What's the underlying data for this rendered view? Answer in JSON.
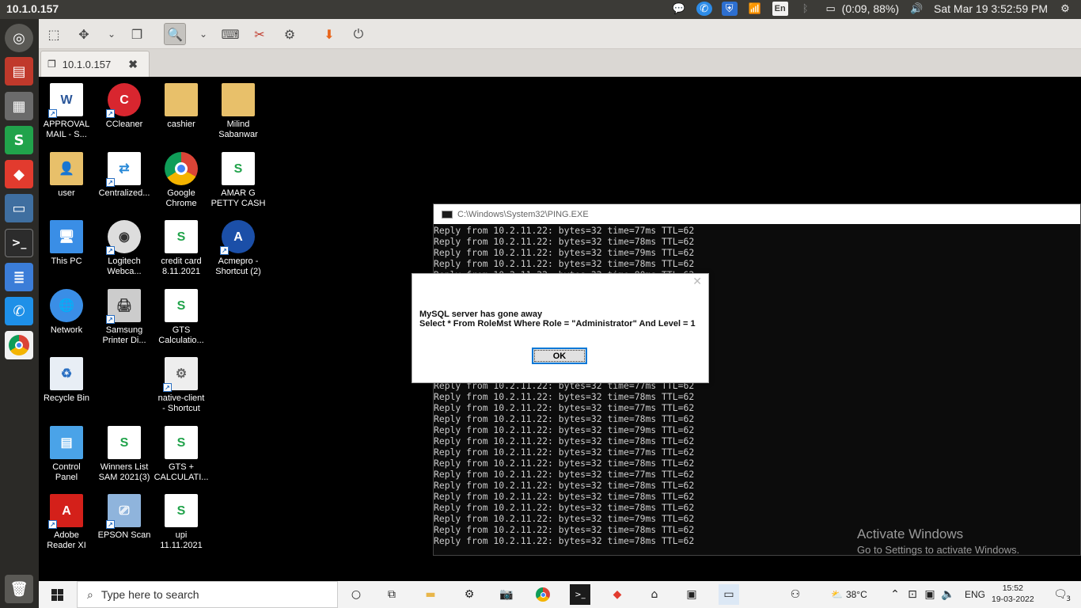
{
  "topbar": {
    "title": "10.1.0.157",
    "language": "En",
    "battery": "(0:09, 88%)",
    "datetime": "Sat Mar 19  3:52:59 PM",
    "icons": [
      "chat-icon",
      "phone-icon",
      "shield-icon",
      "wifi-icon",
      "bluetooth-icon",
      "battery-icon",
      "volume-icon",
      "power-icon"
    ]
  },
  "launcher": {
    "items": [
      "ubuntu-dash",
      "file-manager",
      "calculator",
      "spreadsheet",
      "anydesk",
      "remote-desktop",
      "terminal",
      "text-editor",
      "phone",
      "chrome",
      "trash"
    ]
  },
  "remmina": {
    "tab_label": "10.1.0.157",
    "close_symbol": "✖"
  },
  "desktop_icons": [
    {
      "label": "APPROVAL\nMAIL - S..."
    },
    {
      "label": "CCleaner"
    },
    {
      "label": "cashier"
    },
    {
      "label": "Milind\nSabanwar"
    },
    {
      "label": "user"
    },
    {
      "label": "Centralized..."
    },
    {
      "label": "Google\nChrome"
    },
    {
      "label": "AMAR G\nPETTY CASH"
    },
    {
      "label": "This PC"
    },
    {
      "label": "Logitech\nWebca..."
    },
    {
      "label": "credit card\n8.11.2021"
    },
    {
      "label": "Acmepro -\nShortcut (2)"
    },
    {
      "label": "Network"
    },
    {
      "label": "Samsung\nPrinter Di..."
    },
    {
      "label": "GTS\nCalculatio..."
    },
    {
      "label": "Recycle Bin"
    },
    {
      "label": "native-client\n- Shortcut"
    },
    {
      "label": "Control\nPanel"
    },
    {
      "label": "Winners List\nSAM 2021(3)"
    },
    {
      "label": "GTS +\nCALCULATI..."
    },
    {
      "label": "Adobe\nReader XI"
    },
    {
      "label": "EPSON Scan"
    },
    {
      "label": "upi\n11.11.2021"
    }
  ],
  "console": {
    "title": "C:\\Windows\\System32\\PING.EXE",
    "lines": [
      "Reply from 10.2.11.22: bytes=32 time=77ms TTL=62",
      "Reply from 10.2.11.22: bytes=32 time=78ms TTL=62",
      "Reply from 10.2.11.22: bytes=32 time=79ms TTL=62",
      "Reply from 10.2.11.22: bytes=32 time=78ms TTL=62",
      "Reply from 10.2.11.22: bytes=32 time=80ms TTL=62",
      "Reply from 10.2.11.22: bytes=32 time=78ms TTL=62",
      "Reply from 10.2.11.22: bytes=32 time=78ms TTL=62",
      "Reply from 10.2.11.22: bytes=32 time=78ms TTL=62",
      "Reply from 10.2.11.22: bytes=32 time=78ms TTL=62",
      "Reply from 10.2.11.22: bytes=32 time=78ms TTL=62",
      "Reply from 10.2.11.22: bytes=32 time=78ms TTL=62",
      "Reply from 10.2.11.22: bytes=32 time=78ms TTL=62",
      "Reply from 10.2.11.22: bytes=32 time=78ms TTL=62",
      "Reply from 10.2.11.22: bytes=32 time=78ms TTL=62",
      "Reply from 10.2.11.22: bytes=32 time=77ms TTL=62",
      "Reply from 10.2.11.22: bytes=32 time=78ms TTL=62",
      "Reply from 10.2.11.22: bytes=32 time=77ms TTL=62",
      "Reply from 10.2.11.22: bytes=32 time=78ms TTL=62",
      "Reply from 10.2.11.22: bytes=32 time=79ms TTL=62",
      "Reply from 10.2.11.22: bytes=32 time=78ms TTL=62",
      "Reply from 10.2.11.22: bytes=32 time=77ms TTL=62",
      "Reply from 10.2.11.22: bytes=32 time=78ms TTL=62",
      "Reply from 10.2.11.22: bytes=32 time=77ms TTL=62",
      "Reply from 10.2.11.22: bytes=32 time=78ms TTL=62",
      "Reply from 10.2.11.22: bytes=32 time=78ms TTL=62",
      "Reply from 10.2.11.22: bytes=32 time=78ms TTL=62",
      "Reply from 10.2.11.22: bytes=32 time=79ms TTL=62",
      "Reply from 10.2.11.22: bytes=32 time=78ms TTL=62",
      "Reply from 10.2.11.22: bytes=32 time=78ms TTL=62"
    ]
  },
  "dialog": {
    "close_symbol": "✕",
    "message_line1": "MySQL server has gone away",
    "message_line2": "Select * From RoleMst Where Role = \"Administrator\" And Level = 1",
    "ok_label": "OK"
  },
  "watermark": {
    "title": "Activate Windows",
    "subtitle": "Go to Settings to activate Windows."
  },
  "taskbar": {
    "search_placeholder": "Type here to search",
    "weather": "38°C",
    "language": "ENG",
    "time": "15:52",
    "date": "19-03-2022",
    "notification_count": "3"
  }
}
